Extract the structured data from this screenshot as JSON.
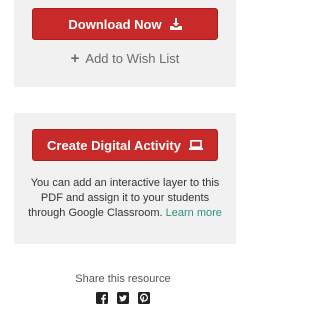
{
  "download": {
    "label": "Download Now",
    "icon": "download-icon",
    "color": "#c82a2a"
  },
  "wishlist": {
    "label": "Add to Wish List",
    "icon": "plus-icon"
  },
  "digital_activity": {
    "label": "Create Digital Activity",
    "icon": "laptop-icon",
    "description": "You can add an interactive layer to this PDF and assign it to your students through Google Classroom.",
    "learn_more": "Learn more",
    "link_color": "#2f8f7f"
  },
  "share": {
    "label": "Share this resource",
    "icons": [
      "facebook-icon",
      "twitter-icon",
      "pinterest-icon"
    ]
  }
}
